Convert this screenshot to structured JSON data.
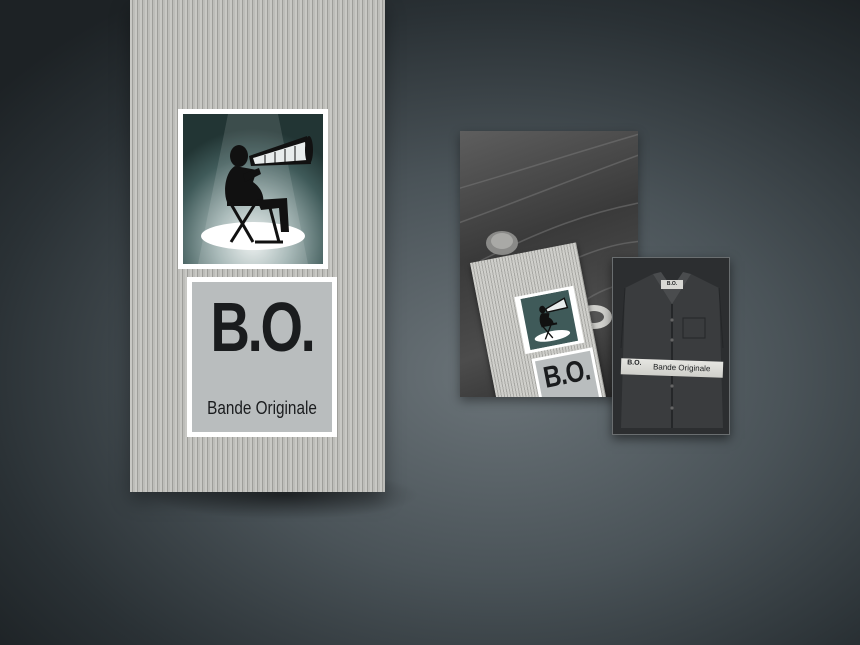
{
  "brand": {
    "logo_text": "B.O.",
    "name": "Bande Originale"
  },
  "photo_tag": {
    "logo_text": "B.O."
  },
  "shirt": {
    "collar_label": "B.O.",
    "band_mark": "B.O.",
    "band_label": "Bande Originale"
  },
  "colors": {
    "spotlight_teal": "#2f4a4a",
    "logo_panel_gray": "#b9bdbe",
    "ink": "#1a1c1e"
  },
  "icons": {
    "mascot": "director-with-megaphone-icon"
  }
}
